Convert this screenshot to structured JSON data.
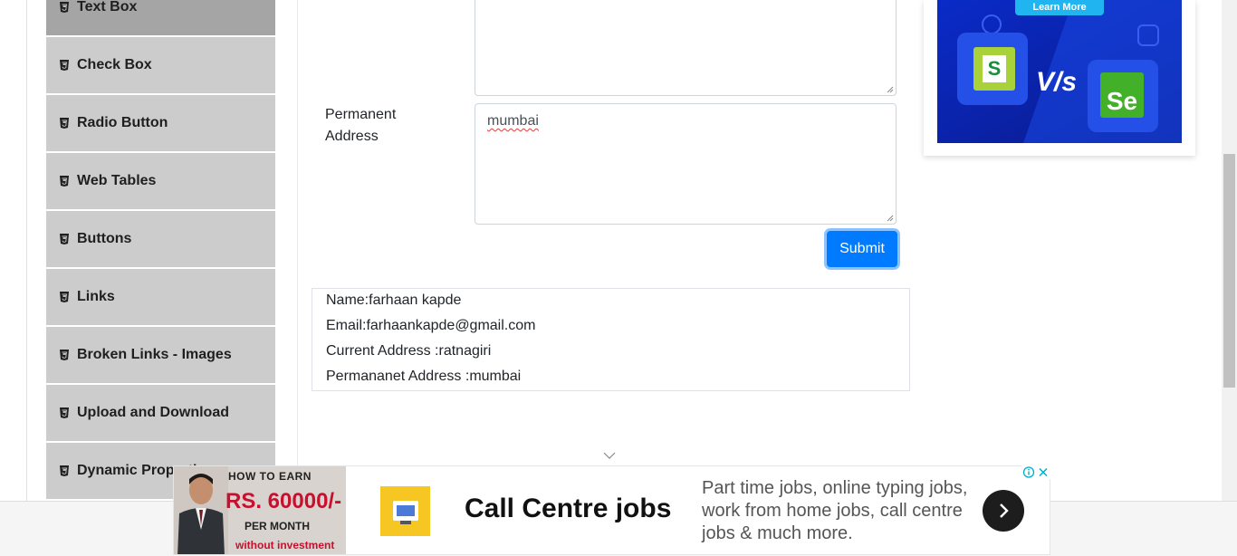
{
  "sidebar": {
    "items": [
      {
        "label": "Text Box",
        "active": true
      },
      {
        "label": "Check Box"
      },
      {
        "label": "Radio Button"
      },
      {
        "label": "Web Tables"
      },
      {
        "label": "Buttons"
      },
      {
        "label": "Links"
      },
      {
        "label": "Broken Links - Images"
      },
      {
        "label": "Upload and Download"
      },
      {
        "label": "Dynamic Properties"
      }
    ]
  },
  "form": {
    "permanent_address_label": "Permanent Address",
    "permanent_address_value": "mumbai",
    "submit_label": "Submit"
  },
  "output": {
    "name": "Name:farhaan kapde",
    "email": "Email:farhaankapde@gmail.com",
    "current_address": "Current Address :ratnagiri",
    "permanent_address": "Permananet Address :mumbai"
  },
  "side_ad": {
    "button_label": "Learn More",
    "vs_text": "V/s",
    "left_logo": "S",
    "right_logo": "Se"
  },
  "bottom_ad": {
    "promo_line1": "HOW TO EARN",
    "promo_line2": "RS. 60000/-",
    "promo_line3": "PER MONTH",
    "promo_line4": "without investment",
    "title": "Call Centre jobs",
    "description": "Part time jobs, online typing jobs, work from home jobs, call centre jobs & much more."
  },
  "colors": {
    "primary": "#007bff",
    "sidebar_bg": "#cccccc",
    "sidebar_active": "#a5a5a5"
  }
}
